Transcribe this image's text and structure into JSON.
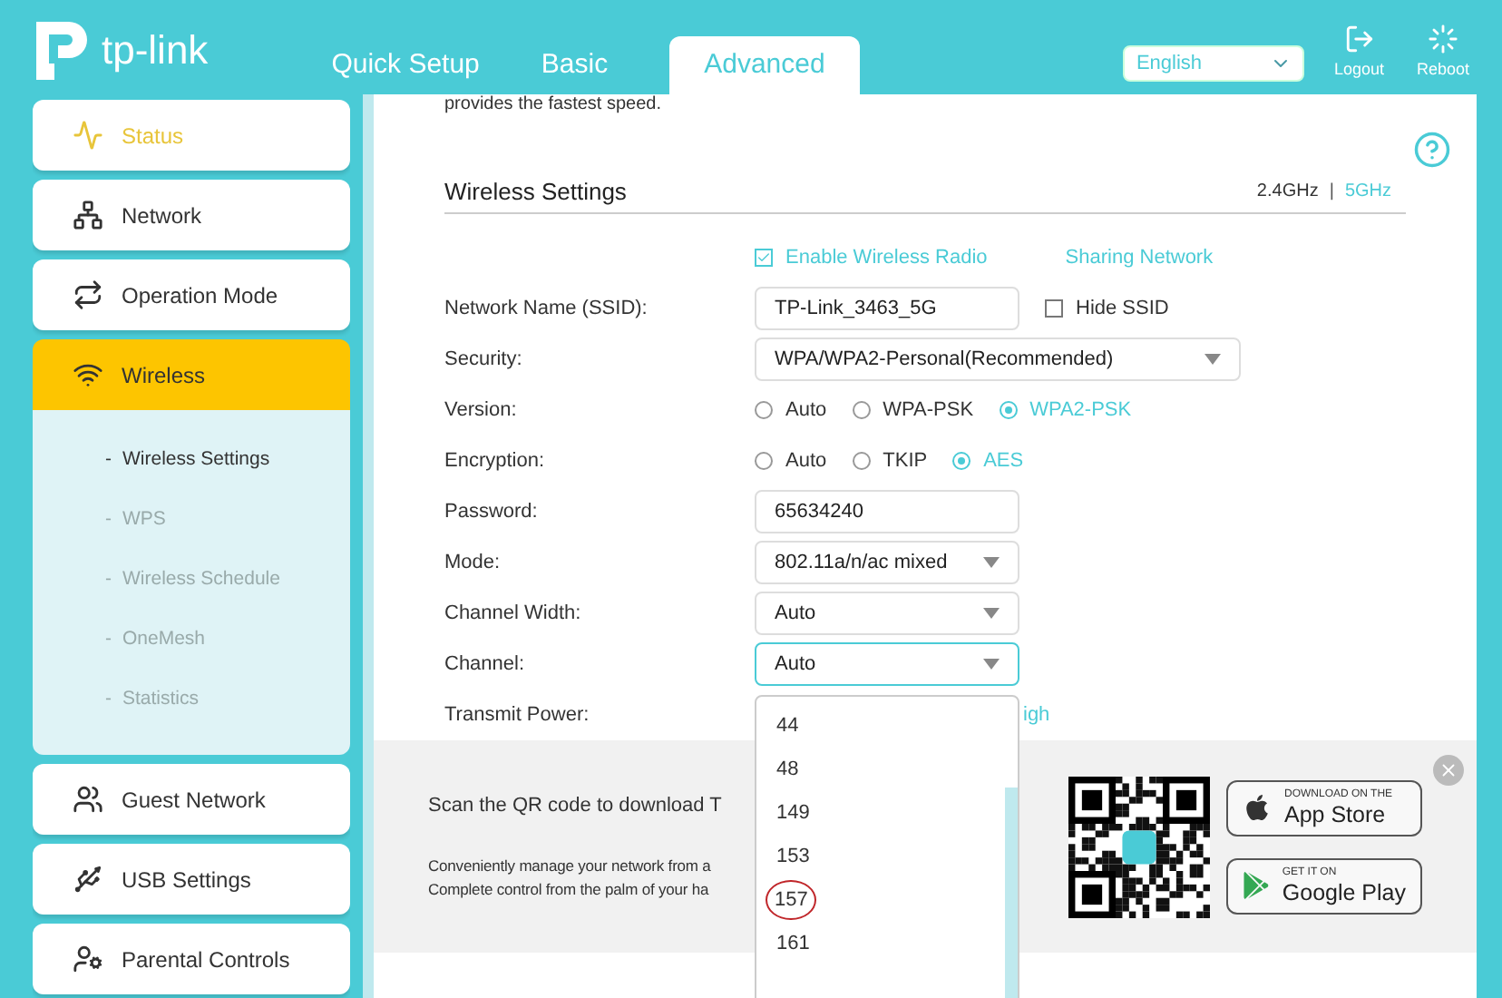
{
  "header": {
    "logo": "tp-link",
    "tabs": [
      {
        "label": "Quick Setup",
        "selected": false
      },
      {
        "label": "Basic",
        "selected": false
      },
      {
        "label": "Advanced",
        "selected": true
      }
    ],
    "language": "English",
    "actions": [
      {
        "label": "Logout",
        "kind": "logout"
      },
      {
        "label": "Reboot",
        "kind": "reboot"
      }
    ]
  },
  "sidebar": {
    "items": [
      {
        "label": "Status",
        "kind": "status",
        "selected": false,
        "hovered": true
      },
      {
        "label": "Network",
        "kind": "network",
        "selected": false,
        "hovered": false
      },
      {
        "label": "Operation Mode",
        "kind": "mode",
        "selected": false,
        "hovered": false
      },
      {
        "label": "Wireless",
        "kind": "wireless",
        "selected": true,
        "hovered": false,
        "children": [
          {
            "marker": "-",
            "label": "Wireless Settings",
            "selected": true
          },
          {
            "marker": "-",
            "label": "WPS",
            "selected": false
          },
          {
            "marker": "-",
            "label": "Wireless Schedule",
            "selected": false
          },
          {
            "marker": "-",
            "label": "OneMesh",
            "selected": false
          },
          {
            "marker": "-",
            "label": "Statistics",
            "selected": false
          }
        ]
      },
      {
        "label": "Guest Network",
        "kind": "guest",
        "selected": false,
        "hovered": false
      },
      {
        "label": "USB Settings",
        "kind": "usb",
        "selected": false,
        "hovered": false
      },
      {
        "label": "Parental Controls",
        "kind": "parental",
        "selected": false,
        "hovered": false
      }
    ]
  },
  "main": {
    "intro": "provides the fastest speed.",
    "title": "Wireless Settings",
    "bands": [
      {
        "label": "2.4GHz",
        "selected": false
      },
      {
        "label": "5GHz",
        "selected": true
      }
    ],
    "band_separator": "|",
    "enable_radio": {
      "label": "Enable Wireless Radio",
      "checked": true
    },
    "sharing_link": "Sharing Network",
    "fields": [
      {
        "kind": "text",
        "label": "Network Name (SSID):",
        "value": "TP-Link_3463_5G",
        "extra": {
          "label": "Hide SSID",
          "checked": false
        }
      },
      {
        "kind": "select",
        "label": "Security:",
        "value": "WPA/WPA2-Personal(Recommended)",
        "wide": true
      },
      {
        "kind": "radio",
        "label": "Version:",
        "options": [
          {
            "label": "Auto",
            "selected": false
          },
          {
            "label": "WPA-PSK",
            "selected": false
          },
          {
            "label": "WPA2-PSK",
            "selected": true
          }
        ]
      },
      {
        "kind": "radio",
        "label": "Encryption:",
        "options": [
          {
            "label": "Auto",
            "selected": false
          },
          {
            "label": "TKIP",
            "selected": false
          },
          {
            "label": "AES",
            "selected": true
          }
        ]
      },
      {
        "kind": "text",
        "label": "Password:",
        "value": "65634240"
      },
      {
        "kind": "select",
        "label": "Mode:",
        "value": "802.11a/n/ac mixed"
      },
      {
        "kind": "select",
        "label": "Channel Width:",
        "value": "Auto"
      },
      {
        "kind": "select",
        "label": "Channel:",
        "value": "Auto",
        "expanded": true
      },
      {
        "kind": "partial",
        "label": "Transmit Power:",
        "value": "igh"
      }
    ],
    "channel_options": [
      {
        "label": "44",
        "circled": false
      },
      {
        "label": "48",
        "circled": false
      },
      {
        "label": "149",
        "circled": false
      },
      {
        "label": "153",
        "circled": false
      },
      {
        "label": "157",
        "circled": true
      },
      {
        "label": "161",
        "circled": false
      }
    ]
  },
  "banner": {
    "title": "Scan the QR code to download T",
    "lines": [
      "Conveniently manage your network from a",
      "Complete control from the palm of your ha"
    ],
    "stores": [
      {
        "kind": "apple",
        "small": "DOWNLOAD ON THE",
        "big": "App Store"
      },
      {
        "kind": "google",
        "small": "GET IT ON",
        "big": "Google Play"
      }
    ]
  }
}
